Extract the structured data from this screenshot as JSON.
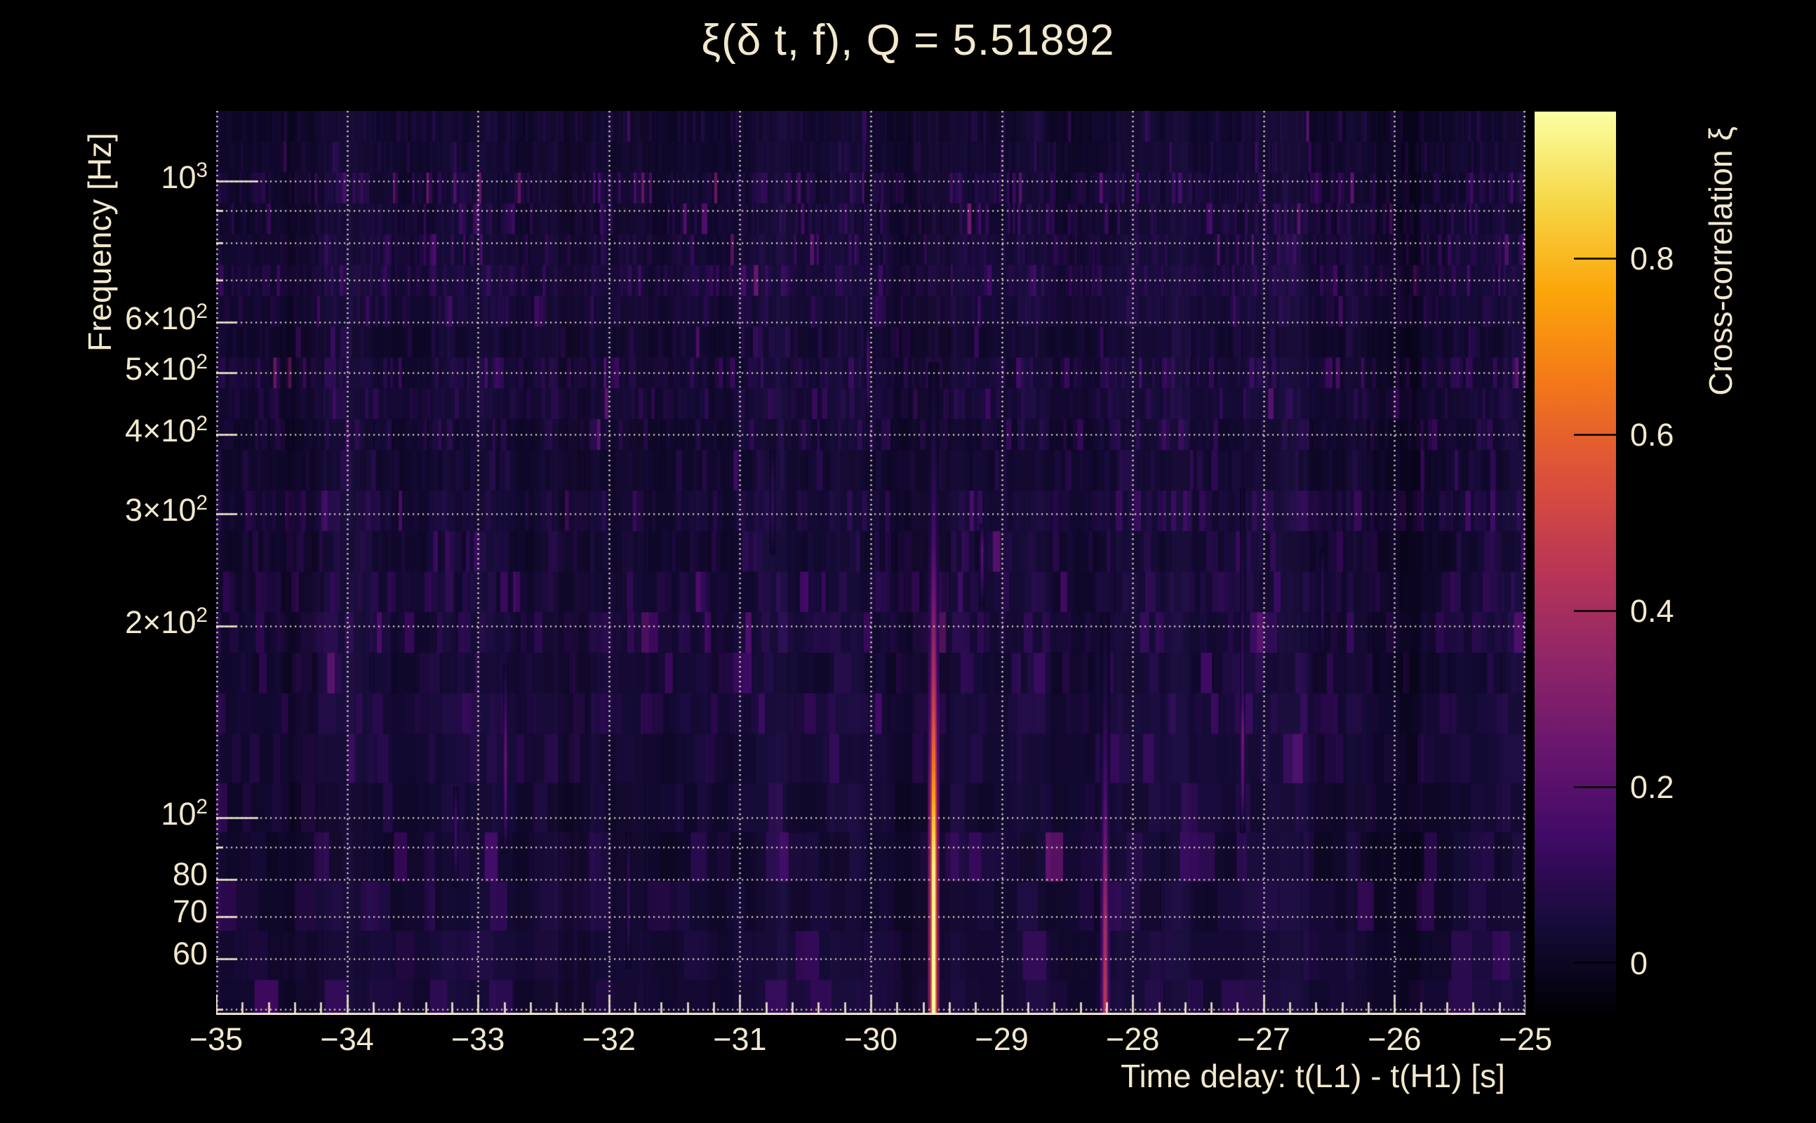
{
  "chart_data": {
    "type": "heatmap",
    "title": "ξ(δ t, f), Q = 5.51892",
    "q_value": 5.51892,
    "xlabel": "Time delay: t(L1) - t(H1) [s]",
    "ylabel": "Frequency [Hz]",
    "zlabel": "Cross-correlation ξ",
    "xlim": [
      -35,
      -25
    ],
    "x_ticks": [
      {
        "t": -35,
        "label": "−35"
      },
      {
        "t": -34,
        "label": "−34"
      },
      {
        "t": -33,
        "label": "−33"
      },
      {
        "t": -32,
        "label": "−32"
      },
      {
        "t": -31,
        "label": "−31"
      },
      {
        "t": -30,
        "label": "−30"
      },
      {
        "t": -29,
        "label": "−29"
      },
      {
        "t": -28,
        "label": "−28"
      },
      {
        "t": -27,
        "label": "−27"
      },
      {
        "t": -26,
        "label": "−26"
      },
      {
        "t": -25,
        "label": "−25"
      }
    ],
    "x_minor_step": 0.2,
    "yscale": "log",
    "ylim_hz": [
      49,
      1290
    ],
    "y_ticks": [
      {
        "f": 1000,
        "label": "10^3",
        "major": true
      },
      {
        "f": 600,
        "label": "6×10^2",
        "major": false
      },
      {
        "f": 500,
        "label": "5×10^2",
        "major": false
      },
      {
        "f": 400,
        "label": "4×10^2",
        "major": false
      },
      {
        "f": 300,
        "label": "3×10^2",
        "major": false
      },
      {
        "f": 200,
        "label": "2×10^2",
        "major": false
      },
      {
        "f": 100,
        "label": "10^2",
        "major": true
      },
      {
        "f": 80,
        "label": "80",
        "major": false
      },
      {
        "f": 70,
        "label": "70",
        "major": false
      },
      {
        "f": 60,
        "label": "60",
        "major": false
      }
    ],
    "y_minor_gridlines_hz": [
      900,
      800,
      700,
      90,
      50
    ],
    "zlim": [
      -0.059,
      0.967
    ],
    "z_ticks": [
      {
        "v": 0,
        "label": "0"
      },
      {
        "v": 0.2,
        "label": "0.2"
      },
      {
        "v": 0.4,
        "label": "0.4"
      },
      {
        "v": 0.6,
        "label": "0.6"
      },
      {
        "v": 0.8,
        "label": "0.8"
      }
    ],
    "colormap": {
      "name": "inferno",
      "stops": [
        {
          "p": 0.0,
          "color": "#000004"
        },
        {
          "p": 0.1,
          "color": "#160b39"
        },
        {
          "p": 0.2,
          "color": "#420a68"
        },
        {
          "p": 0.3,
          "color": "#6a176e"
        },
        {
          "p": 0.4,
          "color": "#932667"
        },
        {
          "p": 0.5,
          "color": "#bc3754"
        },
        {
          "p": 0.6,
          "color": "#dd513a"
        },
        {
          "p": 0.7,
          "color": "#f37819"
        },
        {
          "p": 0.8,
          "color": "#fca50a"
        },
        {
          "p": 0.9,
          "color": "#f6d746"
        },
        {
          "p": 1.0,
          "color": "#fcffa4"
        }
      ]
    },
    "grid": {
      "style": "dotted",
      "color": "#efe5c6"
    },
    "noise_floor_xi_max": 0.12,
    "events": [
      {
        "name": "primary-correlation-peak",
        "time_delay_s": -29.52,
        "f_span_hz": [
          49,
          520
        ],
        "peak_xi": 0.97,
        "width_scale": 1.0,
        "profile": [
          [
            49,
            0.97
          ],
          [
            85,
            0.93
          ],
          [
            105,
            0.78
          ],
          [
            130,
            0.6
          ],
          [
            165,
            0.42
          ],
          [
            210,
            0.28
          ],
          [
            270,
            0.16
          ],
          [
            340,
            0.09
          ],
          [
            430,
            0.04
          ],
          [
            520,
            0.015
          ]
        ]
      },
      {
        "name": "secondary-correlation-peak",
        "time_delay_s": -28.21,
        "f_span_hz": [
          49,
          210
        ],
        "peak_xi": 0.45,
        "width_scale": 0.9,
        "profile": [
          [
            49,
            0.45
          ],
          [
            68,
            0.38
          ],
          [
            85,
            0.28
          ],
          [
            110,
            0.16
          ],
          [
            150,
            0.07
          ],
          [
            210,
            0.02
          ]
        ]
      },
      {
        "name": "minor-streak-1",
        "time_delay_s": -32.79,
        "f_span_hz": [
          88,
          175
        ],
        "peak_xi": 0.25,
        "width_scale": 0.5,
        "profile": [
          [
            88,
            0.02
          ],
          [
            100,
            0.17
          ],
          [
            125,
            0.25
          ],
          [
            150,
            0.13
          ],
          [
            175,
            0.03
          ]
        ]
      },
      {
        "name": "minor-streak-2",
        "time_delay_s": -33.17,
        "f_span_hz": [
          78,
          112
        ],
        "peak_xi": 0.14,
        "width_scale": 0.5,
        "profile": [
          [
            78,
            0.02
          ],
          [
            88,
            0.13
          ],
          [
            100,
            0.14
          ],
          [
            112,
            0.03
          ]
        ]
      },
      {
        "name": "minor-streak-3",
        "time_delay_s": -29.15,
        "f_span_hz": [
          215,
          290
        ],
        "peak_xi": 0.22,
        "width_scale": 0.5,
        "profile": [
          [
            215,
            0.02
          ],
          [
            240,
            0.16
          ],
          [
            265,
            0.22
          ],
          [
            290,
            0.04
          ]
        ]
      },
      {
        "name": "minor-streak-4",
        "time_delay_s": -30.02,
        "f_span_hz": [
          420,
          600
        ],
        "peak_xi": 0.18,
        "width_scale": 0.5,
        "profile": [
          [
            420,
            0.02
          ],
          [
            470,
            0.14
          ],
          [
            540,
            0.18
          ],
          [
            600,
            0.03
          ]
        ]
      },
      {
        "name": "minor-streak-5",
        "time_delay_s": -27.16,
        "f_span_hz": [
          95,
          330
        ],
        "peak_xi": 0.28,
        "width_scale": 0.5,
        "profile": [
          [
            95,
            0.03
          ],
          [
            110,
            0.2
          ],
          [
            135,
            0.28
          ],
          [
            155,
            0.14
          ],
          [
            220,
            0.08
          ],
          [
            330,
            0.02
          ]
        ]
      },
      {
        "name": "minor-streak-6",
        "time_delay_s": -31.85,
        "f_span_hz": [
          58,
          95
        ],
        "peak_xi": 0.12,
        "width_scale": 0.5,
        "profile": [
          [
            58,
            0.02
          ],
          [
            70,
            0.12
          ],
          [
            85,
            0.1
          ],
          [
            95,
            0.02
          ]
        ]
      },
      {
        "name": "minor-streak-7",
        "time_delay_s": -26.55,
        "f_span_hz": [
          180,
          265
        ],
        "peak_xi": 0.11,
        "width_scale": 0.5,
        "profile": [
          [
            180,
            0.02
          ],
          [
            210,
            0.11
          ],
          [
            240,
            0.09
          ],
          [
            265,
            0.02
          ]
        ]
      },
      {
        "name": "minor-streak-8",
        "time_delay_s": -30.75,
        "f_span_hz": [
          260,
          380
        ],
        "peak_xi": 0.12,
        "width_scale": 0.5,
        "profile": [
          [
            260,
            0.02
          ],
          [
            300,
            0.12
          ],
          [
            340,
            0.1
          ],
          [
            380,
            0.02
          ]
        ]
      }
    ]
  },
  "colors": {
    "background": "#000000",
    "text": "#f2e8cc",
    "grid": "#efe5c6",
    "axis": "#f2e8cc"
  }
}
